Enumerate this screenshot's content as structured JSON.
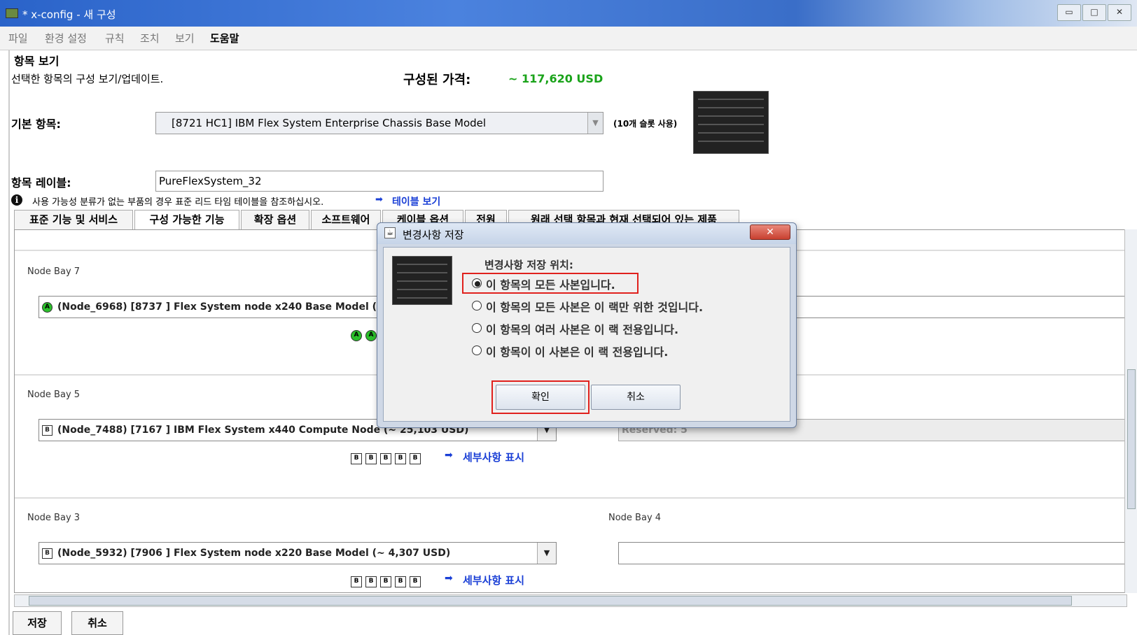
{
  "window": {
    "title": "* x-config - 새 구성",
    "buttons": [
      "▭",
      "□",
      "✕"
    ]
  },
  "menu": [
    "파일",
    "환경 설정",
    "규칙",
    "조치",
    "보기",
    "도움말"
  ],
  "panel": {
    "title": "항목 보기",
    "subtitle": "선택한 항목의 구성 보기/업데이트.",
    "price_label": "구성된 가격:",
    "price_value": "~ 117,620 USD",
    "base_label": "기본 항목:",
    "base_value": "[8721 HC1] IBM Flex System Enterprise Chassis Base Model",
    "slots": "(10개 슬롯 사용)",
    "item_label": "항목 레이블:",
    "item_value": "PureFlexSystem_32",
    "info_text": "사용 가능성 분류가 없는 부품의 경우 표준 리드 타임 테이블을 참조하십시오.",
    "info_link": "테이블 보기"
  },
  "tabs": [
    "표준 기능 및 서비스",
    "구성 가능한 기능",
    "확장 옵션",
    "소프트웨어",
    "케이블 옵션",
    "전원",
    "원래 선택 항목과 현재 선택되어 있는 제품"
  ],
  "bays": {
    "bay7": {
      "label": "Node Bay 7",
      "value": "(Node_6968) [8737 ] Flex System node x240  Base Model (~ 5,8",
      "badge": "A"
    },
    "bay5": {
      "label": "Node Bay 5",
      "value": "(Node_7488) [7167 ] IBM Flex System x440 Compute Node (~ 25,103 USD)",
      "badge": "B",
      "reserved": "Reserved: 5"
    },
    "bay3": {
      "label": "Node Bay 3",
      "value": "(Node_5932) [7906 ] Flex System node x220  Base Model (~ 4,307 USD)",
      "badge": "B"
    },
    "bay4": {
      "label": "Node Bay 4",
      "value": ""
    },
    "details_link": "세부사항 표시"
  },
  "bottom": {
    "save": "저장",
    "cancel": "취소"
  },
  "dialog": {
    "title": "변경사항 저장",
    "close": "✕",
    "prompt": "변경사항 저장 위치:",
    "options": [
      "이 항목의 모든 사본입니다.",
      "이 항목의 모든 사본은 이 랙만 위한 것입니다.",
      "이 항목의 여러 사본은 이 랙 전용입니다.",
      "이 항목이 이 사본은 이 랙 전용입니다."
    ],
    "ok": "확인",
    "cancel": "취소"
  }
}
